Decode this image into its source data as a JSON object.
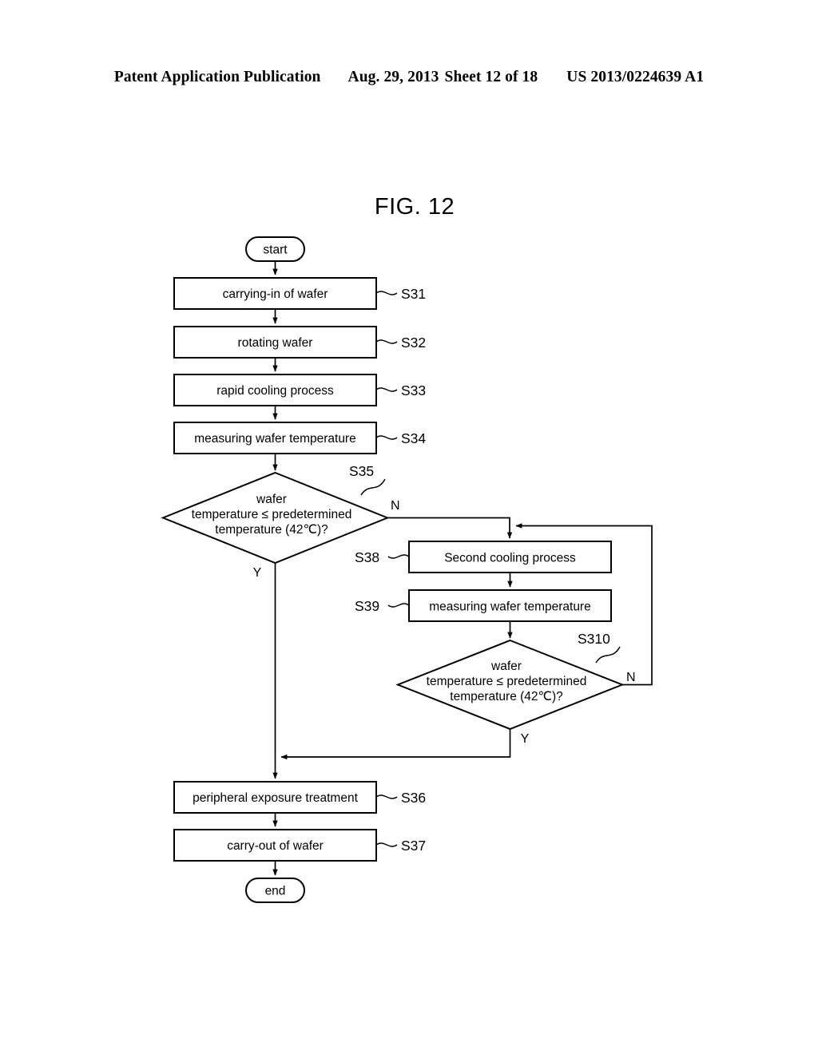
{
  "header": {
    "publication": "Patent Application Publication",
    "date": "Aug. 29, 2013",
    "sheet": "Sheet 12 of 18",
    "number": "US 2013/0224639 A1"
  },
  "figure": {
    "title": "FIG. 12",
    "terminals": {
      "start": "start",
      "end": "end"
    },
    "steps": [
      {
        "ref": "S31",
        "label": "carrying-in of wafer"
      },
      {
        "ref": "S32",
        "label": "rotating wafer"
      },
      {
        "ref": "S33",
        "label": "rapid cooling process"
      },
      {
        "ref": "S34",
        "label": "measuring wafer temperature"
      },
      {
        "ref": "S36",
        "label": "peripheral exposure treatment"
      },
      {
        "ref": "S37",
        "label": "carry-out of wafer"
      },
      {
        "ref": "S38",
        "label": "Second cooling process"
      },
      {
        "ref": "S39",
        "label": "measuring wafer temperature"
      }
    ],
    "decisions": [
      {
        "ref": "S35",
        "line1": "wafer",
        "line2": "temperature ≤ predetermined",
        "line3": "temperature (42℃)?",
        "yes_label": "Y",
        "no_label": "N"
      },
      {
        "ref": "S310",
        "line1": "wafer",
        "line2": "temperature ≤ predetermined",
        "line3": "temperature (42℃)?",
        "yes_label": "Y",
        "no_label": "N"
      }
    ]
  },
  "colors": {
    "ink": "#000000",
    "paper": "#ffffff"
  }
}
